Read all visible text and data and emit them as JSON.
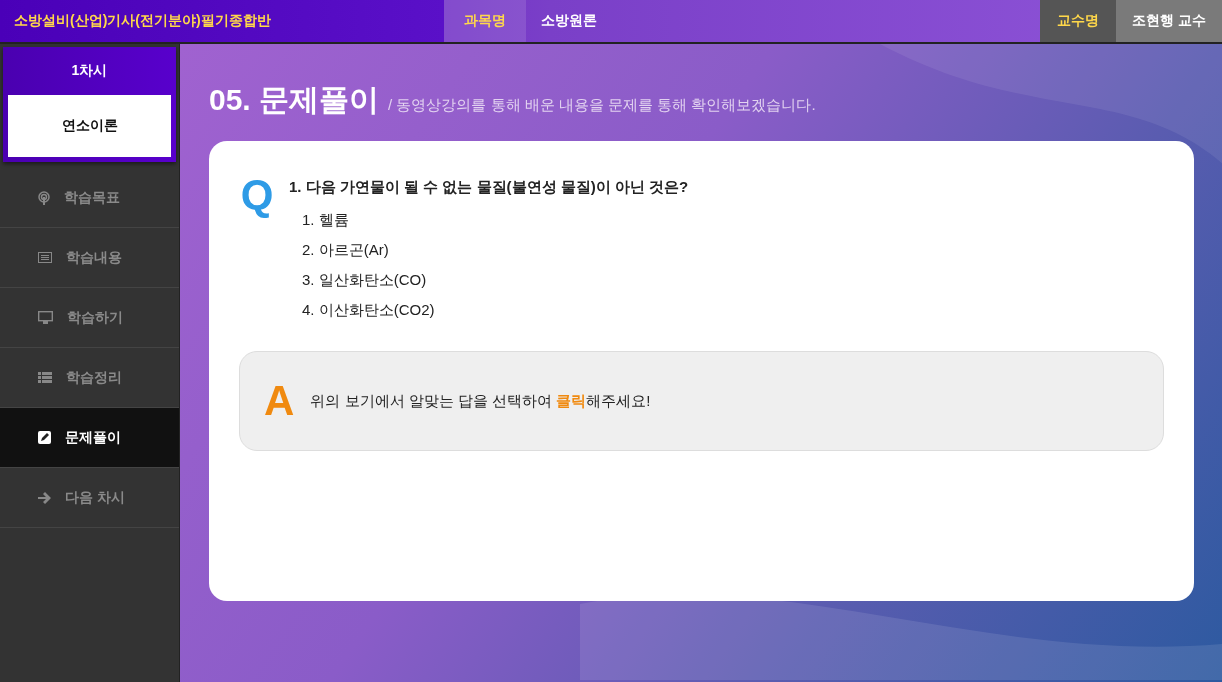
{
  "header": {
    "course_title": "소방설비(산업)기사(전기분야)필기종합반",
    "subject_label": "과목명",
    "subject": "소방원론",
    "professor_label": "교수명",
    "professor": "조현행 교수"
  },
  "sidebar": {
    "session": "1차시",
    "lesson": "연소이론",
    "items": [
      {
        "label": "학습목표",
        "selected": false
      },
      {
        "label": "학습내용",
        "selected": false
      },
      {
        "label": "학습하기",
        "selected": false
      },
      {
        "label": "학습정리",
        "selected": false
      },
      {
        "label": "문제풀이",
        "selected": true
      },
      {
        "label": "다음 차시",
        "selected": false
      }
    ]
  },
  "page": {
    "title": "05. 문제풀이",
    "subtitle": "/ 동영상강의를 통해 배운 내용을 문제를 통해 확인해보겠습니다."
  },
  "question": {
    "mark": "Q",
    "text": "1. 다음 가연물이 될 수 없는 물질(불연성 물질)이 아닌 것은?",
    "options": [
      "1. 헬륨",
      "2. 아르곤(Ar)",
      "3. 일산화탄소(CO)",
      "4. 이산화탄소(CO2)"
    ]
  },
  "answer": {
    "mark": "A",
    "segments": [
      {
        "text": "위의 보기에서 알맞는 답을 선택하여 ",
        "highlight": false
      },
      {
        "text": "클릭",
        "highlight": true
      },
      {
        "text": "해주세요!",
        "highlight": false
      }
    ]
  }
}
